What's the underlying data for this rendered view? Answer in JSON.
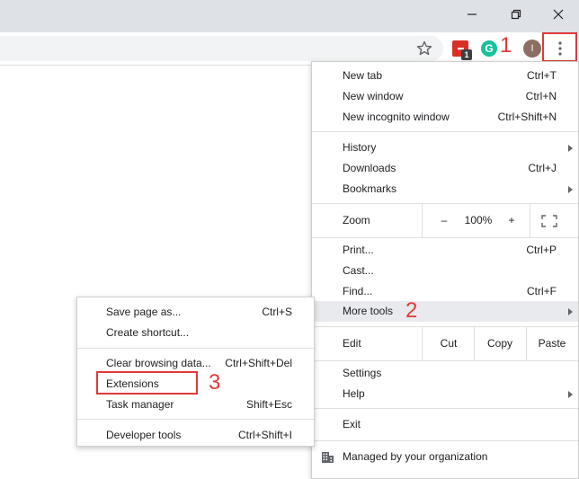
{
  "titlebar": {
    "minimize_icon": "minimize-icon",
    "restore_icon": "restore-icon",
    "close_icon": "close-icon"
  },
  "toolbar": {
    "bookmark_icon": "star-icon",
    "extension1_badge": "1",
    "extension2_letter": "G",
    "avatar_letter": "I",
    "menu_icon": "kebab-menu-icon",
    "accent_highlight": "#e0393b"
  },
  "annotations": {
    "step1": "1",
    "step2": "2",
    "step3": "3"
  },
  "main_menu": {
    "new_tab": {
      "label": "New tab",
      "shortcut": "Ctrl+T"
    },
    "new_window": {
      "label": "New window",
      "shortcut": "Ctrl+N"
    },
    "new_incognito": {
      "label": "New incognito window",
      "shortcut": "Ctrl+Shift+N"
    },
    "history": {
      "label": "History"
    },
    "downloads": {
      "label": "Downloads",
      "shortcut": "Ctrl+J"
    },
    "bookmarks": {
      "label": "Bookmarks"
    },
    "zoom": {
      "label": "Zoom",
      "minus": "–",
      "value": "100%",
      "plus": "+"
    },
    "print": {
      "label": "Print...",
      "shortcut": "Ctrl+P"
    },
    "cast": {
      "label": "Cast..."
    },
    "find": {
      "label": "Find...",
      "shortcut": "Ctrl+F"
    },
    "more_tools": {
      "label": "More tools"
    },
    "edit": {
      "label": "Edit",
      "cut": "Cut",
      "copy": "Copy",
      "paste": "Paste"
    },
    "settings": {
      "label": "Settings"
    },
    "help": {
      "label": "Help"
    },
    "exit": {
      "label": "Exit"
    },
    "managed": {
      "label": "Managed by your organization"
    }
  },
  "sub_menu": {
    "save_page": {
      "label": "Save page as...",
      "shortcut": "Ctrl+S"
    },
    "create_shortcut": {
      "label": "Create shortcut..."
    },
    "clear_browsing": {
      "label": "Clear browsing data...",
      "shortcut": "Ctrl+Shift+Del"
    },
    "extensions": {
      "label": "Extensions"
    },
    "task_manager": {
      "label": "Task manager",
      "shortcut": "Shift+Esc"
    },
    "developer_tools": {
      "label": "Developer tools",
      "shortcut": "Ctrl+Shift+I"
    }
  }
}
